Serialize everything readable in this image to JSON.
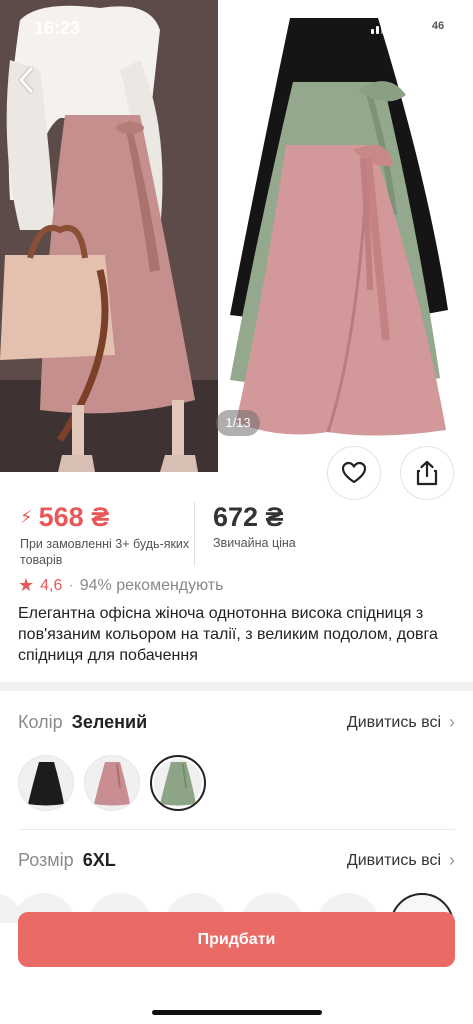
{
  "status_bar": {
    "time": "16:23",
    "battery": "46"
  },
  "gallery": {
    "counter": "1/13"
  },
  "price": {
    "promo_value": "568 ₴",
    "promo_note": "При замовленні 3+ будь-яких товарів",
    "regular_value": "672 ₴",
    "regular_note": "Звичайна ціна",
    "promo_color": "#e8585a"
  },
  "rating": {
    "value": "4,6",
    "separator": "·",
    "recommend": "94% рекомендують"
  },
  "product": {
    "title": "Елегантна офісна жіноча однотонна висока спідниця з пов'язаним кольором на талії, з великим подолом, довга спідниця для побачення"
  },
  "color_option": {
    "label": "Колір",
    "value": "Зелений",
    "see_all": "Дивитись всі",
    "swatches": [
      {
        "name": "black",
        "color": "#1c1c1c"
      },
      {
        "name": "pink",
        "color": "#c98e92"
      },
      {
        "name": "green",
        "color": "#8ea486"
      }
    ]
  },
  "size_option": {
    "label": "Розмір",
    "value": "6XL",
    "see_all": "Дивитись всі"
  },
  "buy": {
    "label": "Придбати",
    "color": "#ea6b66"
  }
}
